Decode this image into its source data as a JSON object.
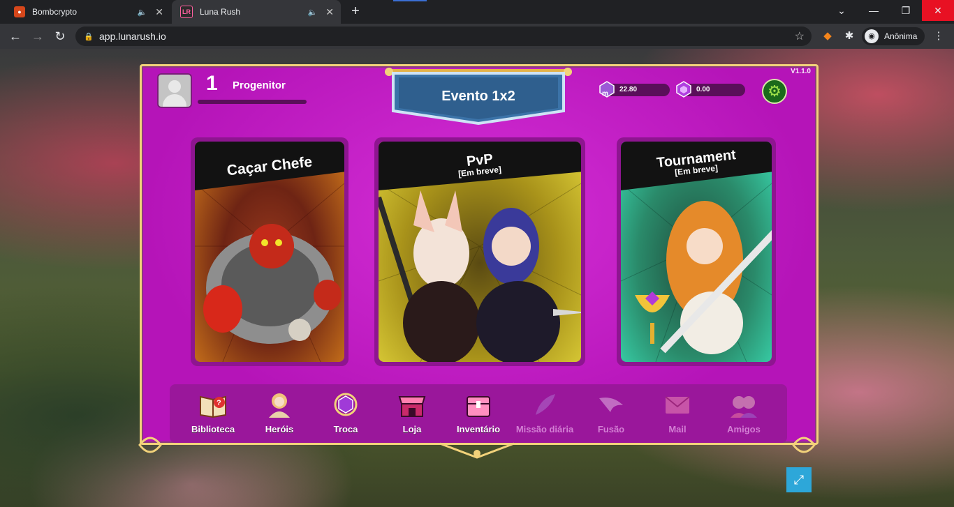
{
  "browser": {
    "tabs": [
      {
        "title": "Bombcrypto",
        "favicon": "bomb-favicon",
        "audio": "speaker-icon"
      },
      {
        "title": "Luna Rush",
        "favicon": "LR",
        "audio": "speaker-icon"
      }
    ],
    "new_tab": "+",
    "url": "app.lunarush.io",
    "profile_label": "Anônima",
    "window_controls": [
      "minimize",
      "restore",
      "close"
    ]
  },
  "game": {
    "player": {
      "level": "1",
      "name": "Progenitor"
    },
    "event_title": "Evento 1x2",
    "version": "V1.1.0",
    "currencies": [
      {
        "name": "mana-gem",
        "value": "22.80",
        "letter": "m"
      },
      {
        "name": "purple-gem",
        "value": "0.00"
      }
    ],
    "modes": [
      {
        "title": "Caçar Chefe",
        "subtitle": ""
      },
      {
        "title": "PvP",
        "subtitle": "[Em breve]"
      },
      {
        "title": "Tournament",
        "subtitle": "[Em breve]"
      }
    ],
    "nav": [
      {
        "label": "Biblioteca",
        "icon": "book-icon",
        "enabled": true
      },
      {
        "label": "Heróis",
        "icon": "hero-icon",
        "enabled": true
      },
      {
        "label": "Troca",
        "icon": "exchange-icon",
        "enabled": true
      },
      {
        "label": "Loja",
        "icon": "shop-icon",
        "enabled": true
      },
      {
        "label": "Inventário",
        "icon": "chest-icon",
        "enabled": true
      },
      {
        "label": "Missão diária",
        "icon": "quill-icon",
        "enabled": false
      },
      {
        "label": "Fusão",
        "icon": "wings-icon",
        "enabled": false
      },
      {
        "label": "Mail",
        "icon": "mail-icon",
        "enabled": false
      },
      {
        "label": "Amigos",
        "icon": "friends-icon",
        "enabled": false
      }
    ]
  },
  "colors": {
    "panel": "#c81ac7",
    "banner": "#3b73a8",
    "gold": "#f2d27a",
    "expand": "#2da7d9"
  }
}
